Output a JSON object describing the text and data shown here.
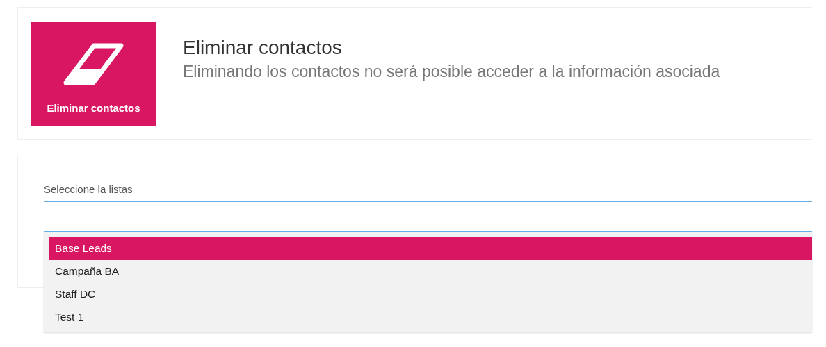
{
  "header": {
    "tile_label": "Eliminar contactos",
    "title": "Eliminar contactos",
    "subtitle": "Eliminando los contactos no será posible acceder a la información asociada"
  },
  "list_select": {
    "label": "Seleccione la listas",
    "focused": true,
    "dropdown_open": true,
    "options": [
      {
        "label": "Base Leads",
        "selected": true
      },
      {
        "label": "Campaña BA",
        "selected": false
      },
      {
        "label": "Staff DC",
        "selected": false
      },
      {
        "label": "Test 1",
        "selected": false
      }
    ]
  }
}
